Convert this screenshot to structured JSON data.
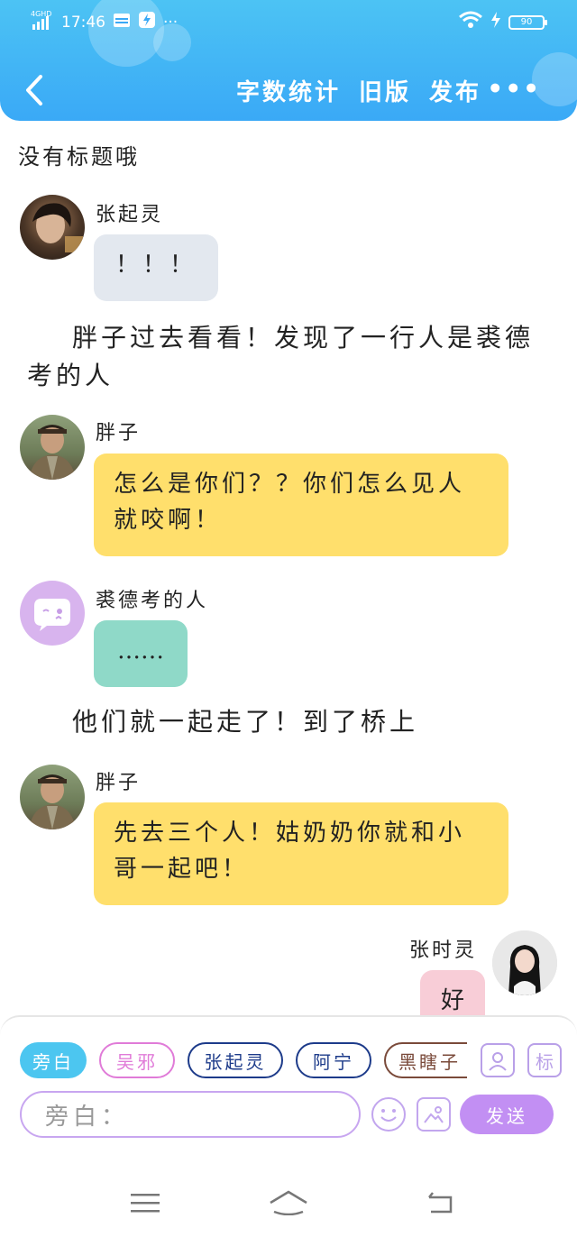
{
  "status_bar": {
    "network": "4GHD",
    "time": "17:46",
    "dots": "···",
    "battery": "90"
  },
  "header": {
    "actions": [
      "字数统计",
      "旧版",
      "发布"
    ],
    "more": "•••"
  },
  "doc": {
    "title": "没有标题哦"
  },
  "messages": [
    {
      "speaker": "张起灵",
      "text": "！！！"
    },
    {
      "narration": "胖子过去看看！发现了一行人是裘德考的人"
    },
    {
      "speaker": "胖子",
      "text": "怎么是你们？？你们怎么见人就咬啊！"
    },
    {
      "speaker": "裘德考的人",
      "text": "……"
    },
    {
      "narration": "他们就一起走了！到了桥上"
    },
    {
      "speaker": "胖子",
      "text": "先去三个人！姑奶奶你就和小哥一起吧！"
    },
    {
      "speaker": "张时灵",
      "text": "好"
    }
  ],
  "input": {
    "chips": [
      "旁白",
      "吴邪",
      "张起灵",
      "阿宁",
      "黑瞎子"
    ],
    "placeholder": "旁白：",
    "tag_icon_label": "标",
    "send": "发送"
  },
  "colors": {
    "header": "#3aa9f6",
    "bubble_gray": "#e3e8ef",
    "bubble_yellow": "#ffdf6c",
    "bubble_teal": "#8fd9c8",
    "bubble_pink": "#f8cdd7",
    "chip_active": "#4cc6f0",
    "chip_pink": "#e07bd8",
    "chip_navy": "#1d3b8a",
    "chip_brown": "#7a4a3a",
    "send": "#c28ff3"
  }
}
